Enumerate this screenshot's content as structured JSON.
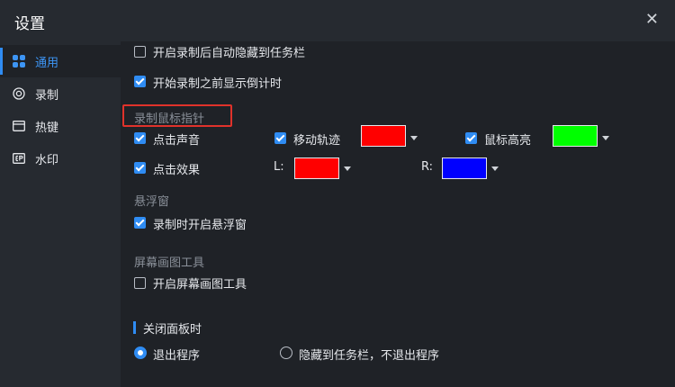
{
  "window": {
    "title": "设置",
    "close_glyph": "✕"
  },
  "sidebar": {
    "items": [
      {
        "label": "通用",
        "icon": "grid-icon",
        "active": true
      },
      {
        "label": "录制",
        "icon": "record-icon",
        "active": false
      },
      {
        "label": "热键",
        "icon": "keyboard-icon",
        "active": false
      },
      {
        "label": "水印",
        "icon": "watermark-icon",
        "active": false
      }
    ]
  },
  "general": {
    "auto_hide_taskbar": {
      "label": "开启录制后自动隐藏到任务栏",
      "checked": false
    },
    "countdown": {
      "label": "开始录制之前显示倒计时",
      "checked": true
    }
  },
  "mouse_pointer": {
    "heading": "录制鼠标指针",
    "click_sound": {
      "label": "点击声音",
      "checked": true
    },
    "move_trail": {
      "label": "移动轨迹",
      "checked": true,
      "color": "#ff0000"
    },
    "cursor_highlight": {
      "label": "鼠标高亮",
      "checked": true,
      "color": "#00ff00"
    },
    "click_effect": {
      "label": "点击效果",
      "checked": true
    },
    "left": {
      "label": "L:",
      "color": "#ff0000"
    },
    "right": {
      "label": "R:",
      "color": "#0000ff"
    }
  },
  "floating_window": {
    "heading": "悬浮窗",
    "enable_during_record": {
      "label": "录制时开启悬浮窗",
      "checked": true
    }
  },
  "screen_draw": {
    "heading": "屏幕画图工具",
    "enable": {
      "label": "开启屏幕画图工具",
      "checked": false
    }
  },
  "close_panel": {
    "heading": "关闭面板时",
    "options": [
      {
        "label": "退出程序",
        "selected": true
      },
      {
        "label": "隐藏到任务栏，不退出程序",
        "selected": false
      }
    ]
  }
}
